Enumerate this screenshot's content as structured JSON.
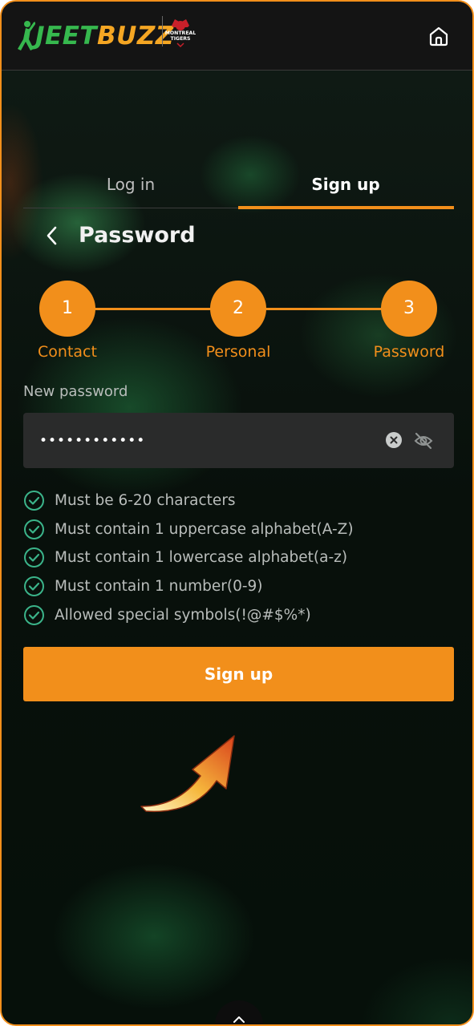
{
  "header": {
    "logo_part1": "JEET",
    "logo_part2": "BUZZ",
    "team_logo_text": "MONTREAL TIGERS",
    "home_icon": "home-icon"
  },
  "tabs": [
    {
      "label": "Log in",
      "active": false
    },
    {
      "label": "Sign up",
      "active": true
    }
  ],
  "page": {
    "title": "Password",
    "back_icon": "chevron-left-icon"
  },
  "stepper": {
    "steps": [
      {
        "number": "1",
        "label": "Contact"
      },
      {
        "number": "2",
        "label": "Personal"
      },
      {
        "number": "3",
        "label": "Password"
      }
    ]
  },
  "form": {
    "field_label": "New password",
    "password_value": "••••••••••••",
    "clear_icon": "clear-icon",
    "visibility_icon": "eye-off-icon"
  },
  "rules": [
    "Must be 6-20 characters",
    "Must contain 1 uppercase alphabet(A-Z)",
    "Must contain 1 lowercase alphabet(a-z)",
    "Must contain 1 number(0-9)",
    "Allowed special symbols(!@#$%*)"
  ],
  "actions": {
    "signup_label": "Sign up"
  },
  "colors": {
    "accent": "#f28f1b",
    "check": "#3bb48a",
    "jeet_green": "#36b84e",
    "buzz_yellow": "#f5a623"
  }
}
